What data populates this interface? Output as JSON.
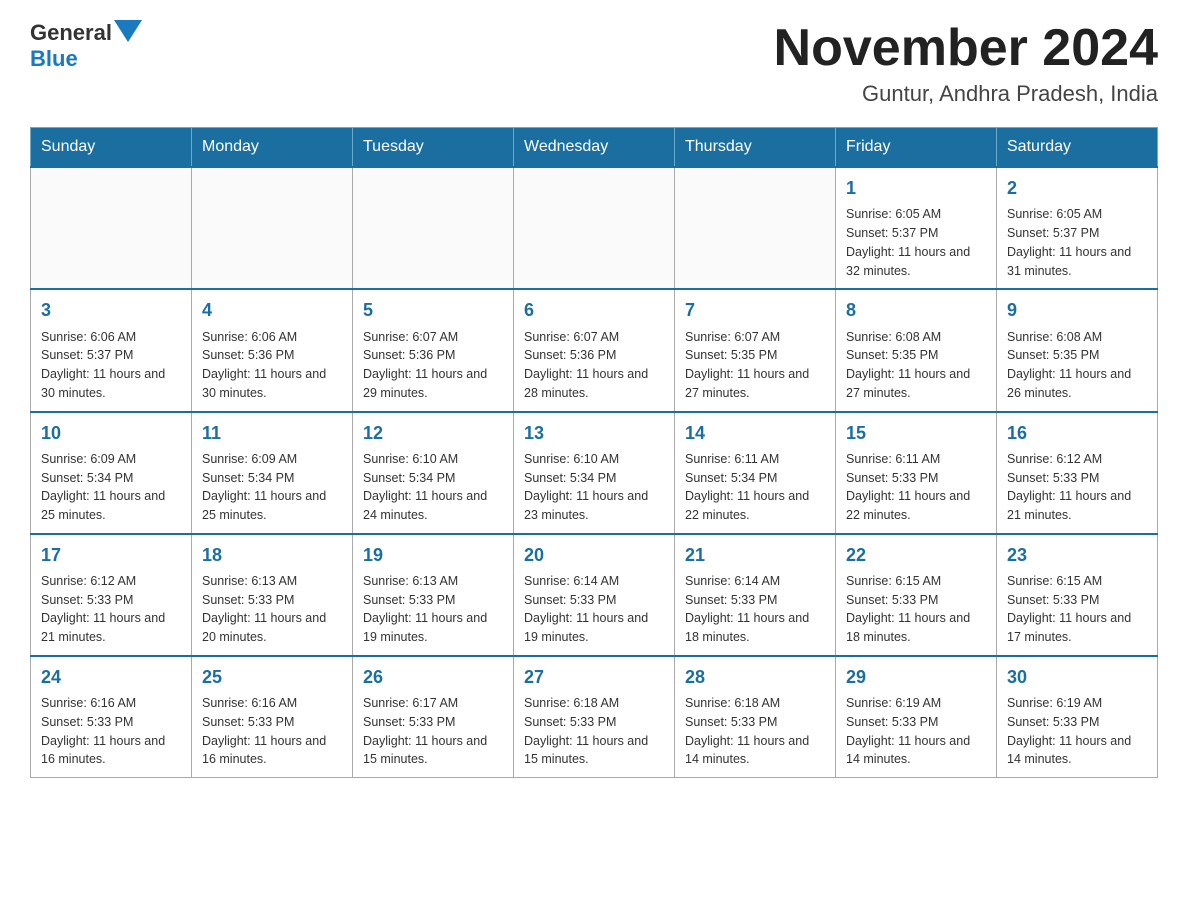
{
  "header": {
    "logo_general": "General",
    "logo_blue": "Blue",
    "month_title": "November 2024",
    "location": "Guntur, Andhra Pradesh, India"
  },
  "weekdays": [
    "Sunday",
    "Monday",
    "Tuesday",
    "Wednesday",
    "Thursday",
    "Friday",
    "Saturday"
  ],
  "weeks": [
    [
      {
        "day": "",
        "info": ""
      },
      {
        "day": "",
        "info": ""
      },
      {
        "day": "",
        "info": ""
      },
      {
        "day": "",
        "info": ""
      },
      {
        "day": "",
        "info": ""
      },
      {
        "day": "1",
        "info": "Sunrise: 6:05 AM\nSunset: 5:37 PM\nDaylight: 11 hours and 32 minutes."
      },
      {
        "day": "2",
        "info": "Sunrise: 6:05 AM\nSunset: 5:37 PM\nDaylight: 11 hours and 31 minutes."
      }
    ],
    [
      {
        "day": "3",
        "info": "Sunrise: 6:06 AM\nSunset: 5:37 PM\nDaylight: 11 hours and 30 minutes."
      },
      {
        "day": "4",
        "info": "Sunrise: 6:06 AM\nSunset: 5:36 PM\nDaylight: 11 hours and 30 minutes."
      },
      {
        "day": "5",
        "info": "Sunrise: 6:07 AM\nSunset: 5:36 PM\nDaylight: 11 hours and 29 minutes."
      },
      {
        "day": "6",
        "info": "Sunrise: 6:07 AM\nSunset: 5:36 PM\nDaylight: 11 hours and 28 minutes."
      },
      {
        "day": "7",
        "info": "Sunrise: 6:07 AM\nSunset: 5:35 PM\nDaylight: 11 hours and 27 minutes."
      },
      {
        "day": "8",
        "info": "Sunrise: 6:08 AM\nSunset: 5:35 PM\nDaylight: 11 hours and 27 minutes."
      },
      {
        "day": "9",
        "info": "Sunrise: 6:08 AM\nSunset: 5:35 PM\nDaylight: 11 hours and 26 minutes."
      }
    ],
    [
      {
        "day": "10",
        "info": "Sunrise: 6:09 AM\nSunset: 5:34 PM\nDaylight: 11 hours and 25 minutes."
      },
      {
        "day": "11",
        "info": "Sunrise: 6:09 AM\nSunset: 5:34 PM\nDaylight: 11 hours and 25 minutes."
      },
      {
        "day": "12",
        "info": "Sunrise: 6:10 AM\nSunset: 5:34 PM\nDaylight: 11 hours and 24 minutes."
      },
      {
        "day": "13",
        "info": "Sunrise: 6:10 AM\nSunset: 5:34 PM\nDaylight: 11 hours and 23 minutes."
      },
      {
        "day": "14",
        "info": "Sunrise: 6:11 AM\nSunset: 5:34 PM\nDaylight: 11 hours and 22 minutes."
      },
      {
        "day": "15",
        "info": "Sunrise: 6:11 AM\nSunset: 5:33 PM\nDaylight: 11 hours and 22 minutes."
      },
      {
        "day": "16",
        "info": "Sunrise: 6:12 AM\nSunset: 5:33 PM\nDaylight: 11 hours and 21 minutes."
      }
    ],
    [
      {
        "day": "17",
        "info": "Sunrise: 6:12 AM\nSunset: 5:33 PM\nDaylight: 11 hours and 21 minutes."
      },
      {
        "day": "18",
        "info": "Sunrise: 6:13 AM\nSunset: 5:33 PM\nDaylight: 11 hours and 20 minutes."
      },
      {
        "day": "19",
        "info": "Sunrise: 6:13 AM\nSunset: 5:33 PM\nDaylight: 11 hours and 19 minutes."
      },
      {
        "day": "20",
        "info": "Sunrise: 6:14 AM\nSunset: 5:33 PM\nDaylight: 11 hours and 19 minutes."
      },
      {
        "day": "21",
        "info": "Sunrise: 6:14 AM\nSunset: 5:33 PM\nDaylight: 11 hours and 18 minutes."
      },
      {
        "day": "22",
        "info": "Sunrise: 6:15 AM\nSunset: 5:33 PM\nDaylight: 11 hours and 18 minutes."
      },
      {
        "day": "23",
        "info": "Sunrise: 6:15 AM\nSunset: 5:33 PM\nDaylight: 11 hours and 17 minutes."
      }
    ],
    [
      {
        "day": "24",
        "info": "Sunrise: 6:16 AM\nSunset: 5:33 PM\nDaylight: 11 hours and 16 minutes."
      },
      {
        "day": "25",
        "info": "Sunrise: 6:16 AM\nSunset: 5:33 PM\nDaylight: 11 hours and 16 minutes."
      },
      {
        "day": "26",
        "info": "Sunrise: 6:17 AM\nSunset: 5:33 PM\nDaylight: 11 hours and 15 minutes."
      },
      {
        "day": "27",
        "info": "Sunrise: 6:18 AM\nSunset: 5:33 PM\nDaylight: 11 hours and 15 minutes."
      },
      {
        "day": "28",
        "info": "Sunrise: 6:18 AM\nSunset: 5:33 PM\nDaylight: 11 hours and 14 minutes."
      },
      {
        "day": "29",
        "info": "Sunrise: 6:19 AM\nSunset: 5:33 PM\nDaylight: 11 hours and 14 minutes."
      },
      {
        "day": "30",
        "info": "Sunrise: 6:19 AM\nSunset: 5:33 PM\nDaylight: 11 hours and 14 minutes."
      }
    ]
  ]
}
